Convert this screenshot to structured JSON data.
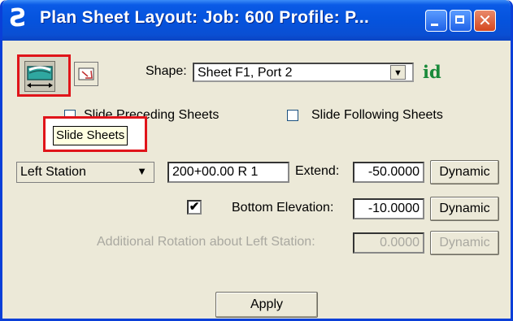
{
  "window": {
    "title": "Plan Sheet Layout:  Job: 600  Profile: P...",
    "app_icon": "microstation-icon",
    "controls": {
      "minimize": "minimize-icon",
      "maximize": "maximize-icon",
      "close": "✕"
    }
  },
  "toolbar": {
    "slide_tool_icon": "slide-sheets-icon",
    "rotate_tool_icon": "rotate-sheet-icon",
    "tooltip": "Slide Sheets"
  },
  "shape": {
    "label": "Shape:",
    "value": "Sheet F1, Port 2",
    "id_icon": "id"
  },
  "slide": {
    "preceding_label": "Slide Preceding Sheets",
    "following_label": "Slide Following Sheets",
    "preceding_checked": false,
    "following_checked": false
  },
  "station": {
    "mode": "Left Station",
    "value": "200+00.00 R 1",
    "extend_label": "Extend:",
    "extend_value": "-50.0000",
    "dynamic_label": "Dynamic"
  },
  "bottom_elevation": {
    "checked": true,
    "check_glyph": "✔",
    "label": "Bottom Elevation:",
    "value": "-10.0000",
    "dynamic_label": "Dynamic"
  },
  "rotation": {
    "label": "Additional Rotation about Left Station:",
    "value": "0.0000",
    "dynamic_label": "Dynamic"
  },
  "apply_label": "Apply",
  "colors": {
    "titlebar": "#0553dd",
    "window_bg": "#ece9d8",
    "highlight": "#e0141a",
    "id_icon": "#1a8a3a"
  }
}
